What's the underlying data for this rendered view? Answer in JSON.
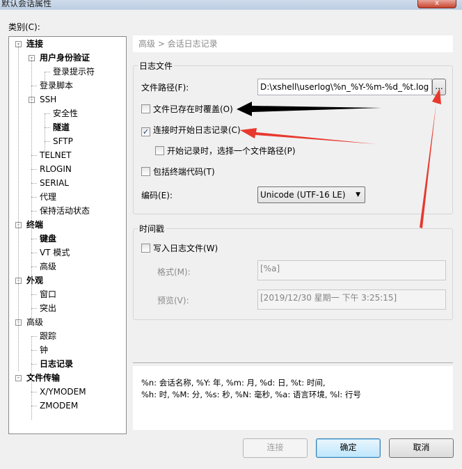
{
  "window": {
    "title": "默认会话属性",
    "close_symbol": "x"
  },
  "category_label": "类别(C):",
  "tree": [
    {
      "label": "连接",
      "bold": true,
      "level": 0,
      "toggle": "-"
    },
    {
      "label": "用户身份验证",
      "bold": true,
      "level": 1,
      "toggle": "-"
    },
    {
      "label": "登录提示符",
      "bold": false,
      "level": 2
    },
    {
      "label": "登录脚本",
      "bold": false,
      "level": 1
    },
    {
      "label": "SSH",
      "bold": false,
      "level": 1,
      "toggle": "-"
    },
    {
      "label": "安全性",
      "bold": false,
      "level": 2
    },
    {
      "label": "隧道",
      "bold": true,
      "level": 2
    },
    {
      "label": "SFTP",
      "bold": false,
      "level": 2
    },
    {
      "label": "TELNET",
      "bold": false,
      "level": 1
    },
    {
      "label": "RLOGIN",
      "bold": false,
      "level": 1
    },
    {
      "label": "SERIAL",
      "bold": false,
      "level": 1
    },
    {
      "label": "代理",
      "bold": false,
      "level": 1
    },
    {
      "label": "保持活动状态",
      "bold": false,
      "level": 1
    },
    {
      "label": "终端",
      "bold": true,
      "level": 0,
      "toggle": "-"
    },
    {
      "label": "键盘",
      "bold": true,
      "level": 1
    },
    {
      "label": "VT 模式",
      "bold": false,
      "level": 1
    },
    {
      "label": "高级",
      "bold": false,
      "level": 1
    },
    {
      "label": "外观",
      "bold": true,
      "level": 0,
      "toggle": "-"
    },
    {
      "label": "窗口",
      "bold": false,
      "level": 1
    },
    {
      "label": "突出",
      "bold": false,
      "level": 1
    },
    {
      "label": "高级",
      "bold": false,
      "level": 0,
      "toggle": "-"
    },
    {
      "label": "跟踪",
      "bold": false,
      "level": 1
    },
    {
      "label": "钟",
      "bold": false,
      "level": 1
    },
    {
      "label": "日志记录",
      "bold": true,
      "level": 1
    },
    {
      "label": "文件传输",
      "bold": true,
      "level": 0,
      "toggle": "-"
    },
    {
      "label": "X/YMODEM",
      "bold": false,
      "level": 1
    },
    {
      "label": "ZMODEM",
      "bold": false,
      "level": 1
    }
  ],
  "breadcrumb": "高级 > 会话日志记录",
  "log_file": {
    "group_title": "日志文件",
    "path_label": "文件路径(F):",
    "path_value": "D:\\xshell\\userlog\\%n_%Y-%m-%d_%t.log",
    "browse_label": "...",
    "overwrite_label": "文件已存在时覆盖(O)",
    "overwrite_checked": false,
    "start_on_connect_label": "连接时开始日志记录(C)",
    "start_on_connect_checked": true,
    "choose_path_label": "开始记录时，选择一个文件路径(P)",
    "choose_path_checked": false,
    "include_codes_label": "包括终端代码(T)",
    "include_codes_checked": false,
    "encoding_label": "编码(E):",
    "encoding_value": "Unicode (UTF-16 LE)"
  },
  "timestamp": {
    "group_title": "时间戳",
    "write_label": "写入日志文件(W)",
    "write_checked": false,
    "format_label": "格式(M):",
    "format_value": "[%a]",
    "preview_label": "预览(V):",
    "preview_value": "[2019/12/30 星期一 下午 3:25:15]"
  },
  "help": {
    "line1": "%n: 会话名称, %Y: 年, %m: 月, %d: 日, %t: 时间,",
    "line2": " %h: 时, %M: 分, %s: 秒, %N: 毫秒, %a: 语言环境, %l: 行号"
  },
  "buttons": {
    "connect": "连接",
    "ok": "确定",
    "cancel": "取消"
  },
  "colors": {
    "annotation_red": "#e8382e",
    "annotation_black": "#000000",
    "accent": "#3c7fb1"
  }
}
